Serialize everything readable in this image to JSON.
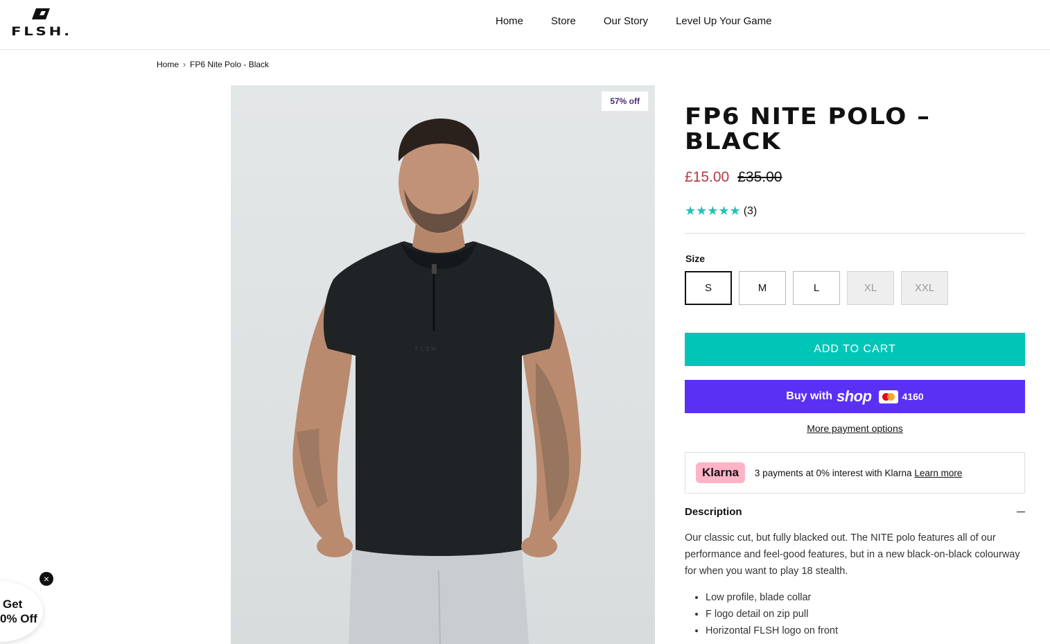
{
  "header": {
    "logo_text": "FLSH.",
    "nav": [
      "Home",
      "Store",
      "Our Story",
      "Level Up Your Game"
    ]
  },
  "breadcrumb": {
    "home": "Home",
    "current": "FP6 Nite Polo - Black"
  },
  "image": {
    "badge": "57% off",
    "shirt_logo": "FLSH"
  },
  "product": {
    "title": "FP6 NITE POLO – BLACK",
    "price_sale": "£15.00",
    "price_old": "£35.00",
    "rating_count": "(3)",
    "rating": 5,
    "size_label": "Size",
    "sizes": [
      "S",
      "M",
      "L",
      "XL",
      "XXL"
    ],
    "add_to_cart": "ADD TO CART",
    "shop_pay": {
      "buy": "Buy with",
      "shop": "shop",
      "last4": "4160"
    },
    "more_payment": "More payment options",
    "klarna": {
      "logo": "Klarna",
      "text": "3 payments at 0% interest with Klarna",
      "link": "Learn more"
    },
    "description_title": "Description",
    "description": "Our classic cut, but fully blacked out. The NITE polo features all of our performance and feel-good features, but in a new black-on-black colourway for when you want to play 18 stealth.",
    "features": [
      "Low profile, blade collar",
      "F logo detail on zip pull",
      "Horizontal FLSH logo on front"
    ]
  },
  "promo": {
    "line1": "Get",
    "line2": "0% Off",
    "close": "×"
  },
  "colors": {
    "accent": "#00c6b8",
    "shop_pay": "#5a31f4",
    "sale": "#b33a44",
    "klarna": "#ffb3c7"
  }
}
